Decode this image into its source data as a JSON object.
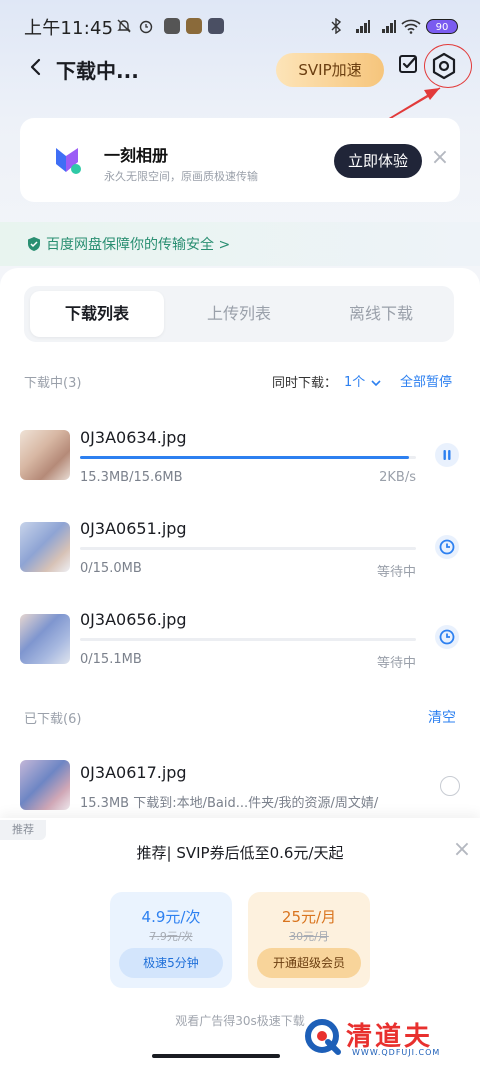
{
  "status_bar": {
    "time": "上午11:45",
    "battery": "90"
  },
  "header": {
    "title": "下载中...",
    "svip_label": "SVIP加速"
  },
  "promo": {
    "title": "一刻相册",
    "subtitle": "永久无限空间，原画质极速传输",
    "button": "立即体验",
    "close": "×"
  },
  "security": {
    "text": "百度网盘保障你的传输安全 >"
  },
  "tabs": [
    {
      "label": "下载列表",
      "active": true
    },
    {
      "label": "上传列表",
      "active": false
    },
    {
      "label": "离线下载",
      "active": false
    }
  ],
  "downloading": {
    "header": "下载中(3)",
    "concurrent_label": "同时下载：",
    "concurrent_value": "1个",
    "pause_all": "全部暂停",
    "items": [
      {
        "name": "0J3A0634.jpg",
        "size": "15.3MB/15.6MB",
        "status": "2KB/s",
        "progress": 0.98,
        "icon": "pause-icon"
      },
      {
        "name": "0J3A0651.jpg",
        "size": "0/15.0MB",
        "status": "等待中",
        "progress": 0,
        "icon": "clock-icon"
      },
      {
        "name": "0J3A0656.jpg",
        "size": "0/15.1MB",
        "status": "等待中",
        "progress": 0,
        "icon": "clock-icon"
      }
    ]
  },
  "downloaded": {
    "header": "已下载(6)",
    "clear": "清空",
    "items": [
      {
        "name": "0J3A0617.jpg",
        "detail": "15.3MB  下载到:本地/Baid...件夹/我的资源/周文婧/"
      }
    ]
  },
  "sheet": {
    "tag": "推荐",
    "title": "推荐| SVIP券后低至0.6元/天起",
    "close": "×",
    "offers": [
      {
        "price": "4.9元/次",
        "old": "7.9元/次",
        "button": "极速5分钟"
      },
      {
        "price": "25元/月",
        "old": "30元/月",
        "button": "开通超级会员"
      }
    ],
    "ad_text": "观看广告得30s极速下载"
  },
  "watermark": {
    "text": "清道夫",
    "sub": "WWW.QDFUJI.COM"
  },
  "colors": {
    "accent": "#2d80f0",
    "annotation": "#e23a3a"
  }
}
